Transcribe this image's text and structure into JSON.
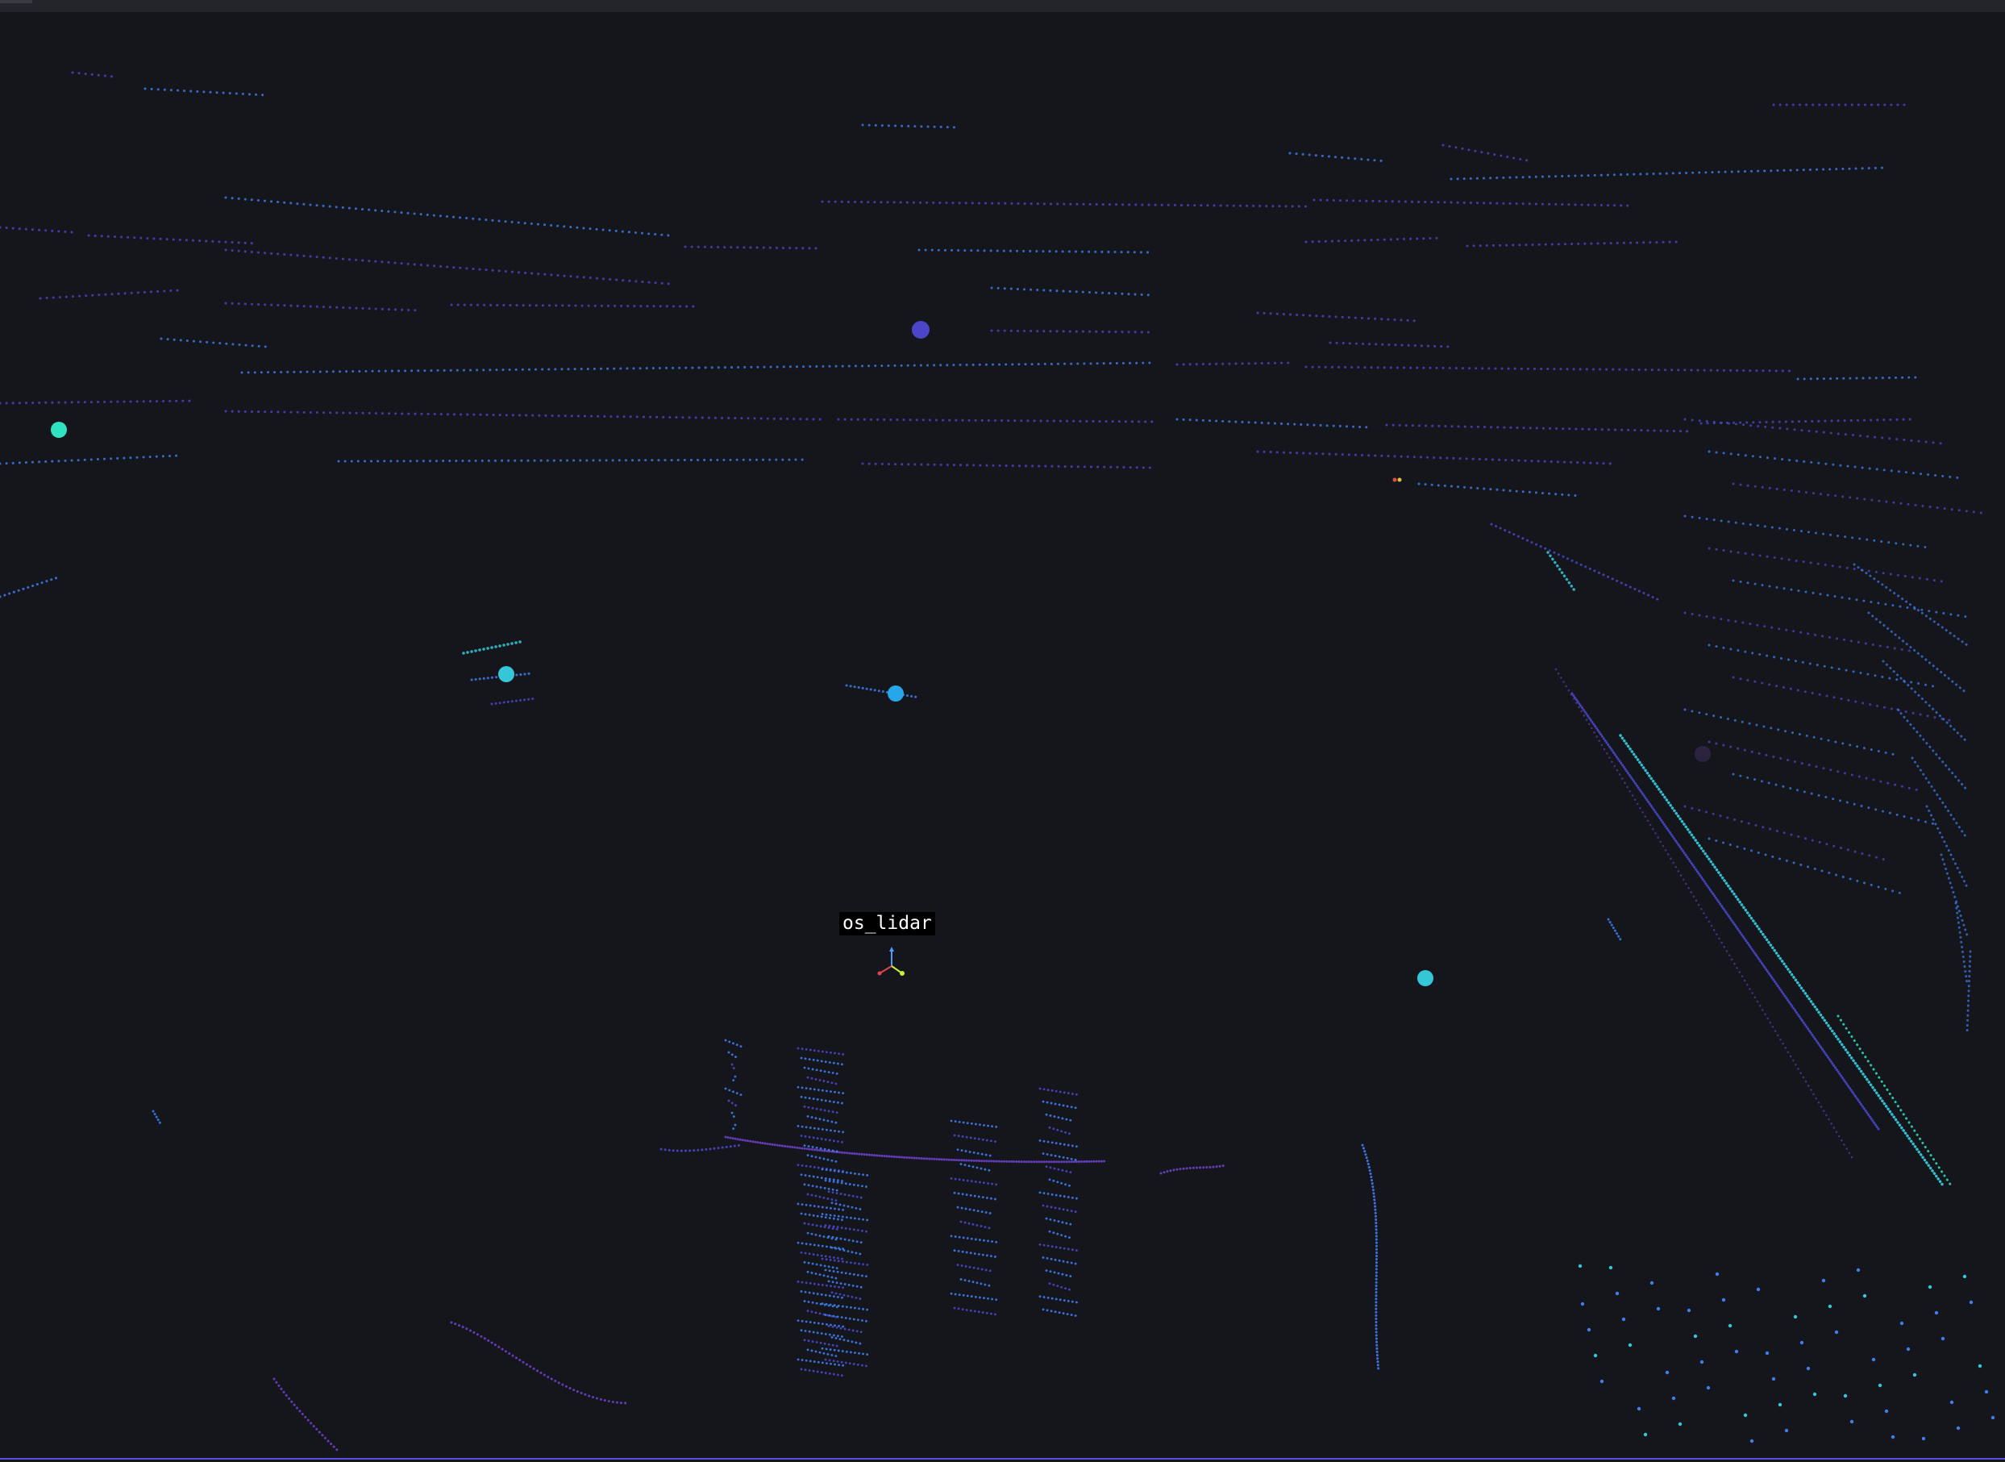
{
  "scene": {
    "background_color": "#15161b",
    "frame": {
      "label": "os_lidar",
      "axis_colors": {
        "x": "#e0444f",
        "y": "#c6f03a",
        "z": "#4a9cff"
      }
    },
    "palette": {
      "far": "#4b46c8",
      "mid": "#3f7df0",
      "near": "#35c7d8",
      "highlight": "#2fe3c2",
      "ground": "#6a3fc6"
    }
  }
}
